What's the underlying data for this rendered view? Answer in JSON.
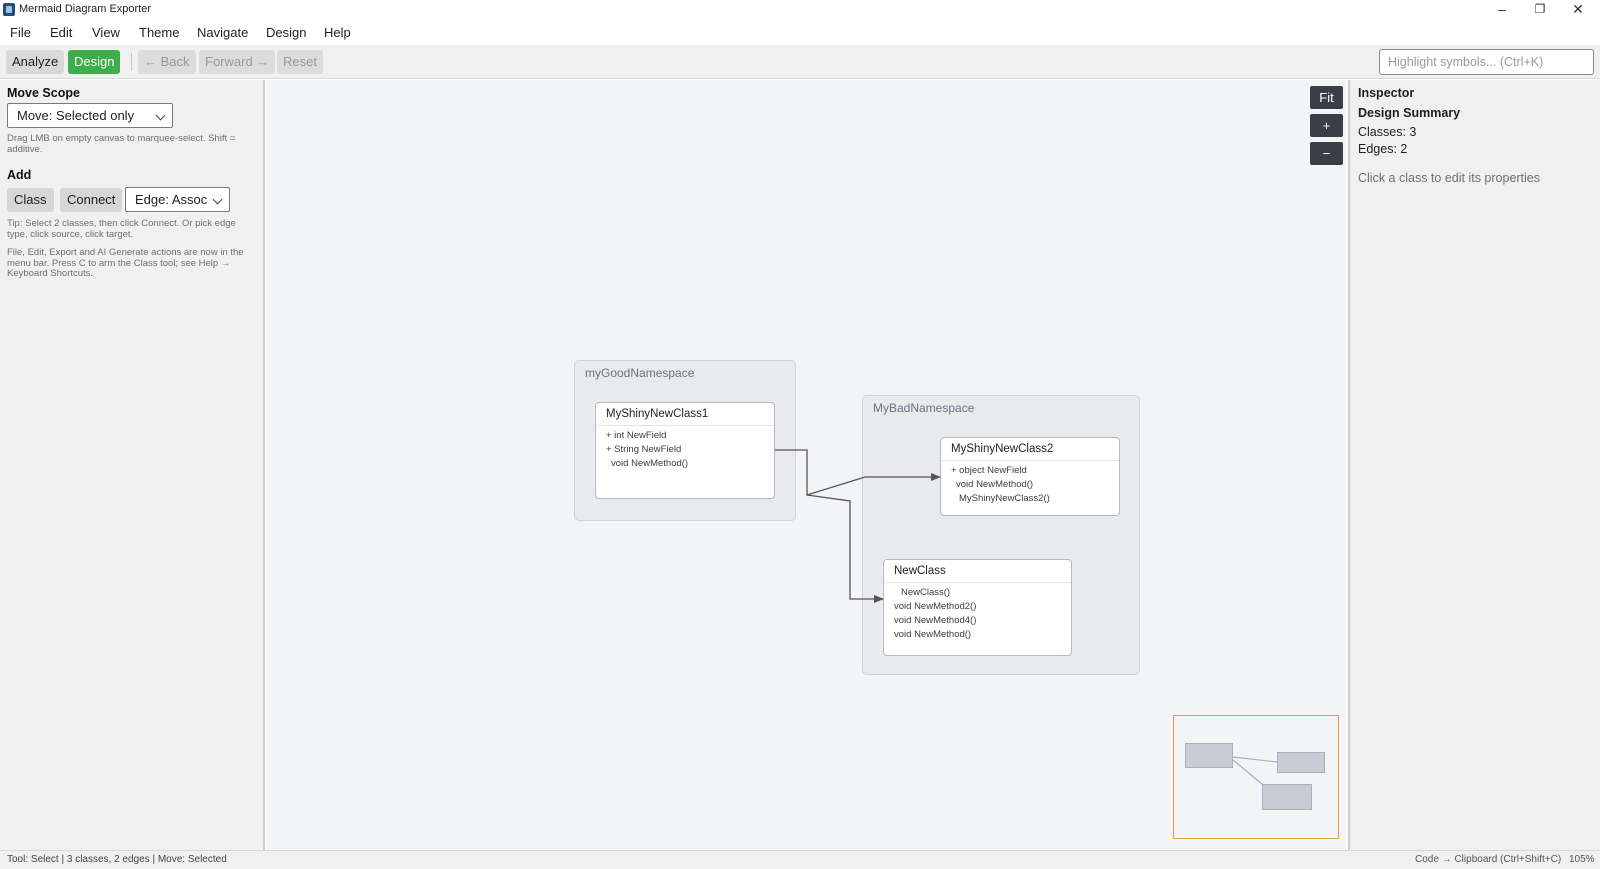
{
  "window": {
    "title": "Mermaid Diagram Exporter",
    "minimize": "–",
    "maximize": "❐",
    "close": "✕"
  },
  "menu": [
    "File",
    "Edit",
    "View",
    "Theme",
    "Navigate",
    "Design",
    "Help"
  ],
  "toolbar": {
    "analyze": "Analyze",
    "design": "Design",
    "back": "← Back",
    "forward": "Forward →",
    "reset": "Reset",
    "search_placeholder": "Highlight symbols... (Ctrl+K)"
  },
  "left_panel": {
    "move_scope_heading": "Move Scope",
    "move_scope_value": "Move: Selected only",
    "move_hint": "Drag LMB on empty canvas to marquee-select. Shift = additive.",
    "add_heading": "Add",
    "class_button": "Class",
    "connect_button": "Connect",
    "edge_type_value": "Edge: Assoc",
    "tip": "Tip: Select 2 classes, then click Connect. Or pick edge type, click source, click target.",
    "info": "File, Edit, Export and AI Generate actions are now in the menu bar. Press C to arm the Class tool; see Help → Keyboard Shortcuts."
  },
  "canvas": {
    "zoom_fit": "Fit",
    "zoom_in": "+",
    "zoom_out": "−",
    "namespaces": [
      {
        "name": "myGoodNamespace",
        "classes": [
          {
            "name": "MyShinyNewClass1",
            "members": [
              "+ int NewField",
              "+ String NewField",
              " void NewMethod()"
            ]
          }
        ]
      },
      {
        "name": "MyBadNamespace",
        "classes": [
          {
            "name": "MyShinyNewClass2",
            "members": [
              "+ object NewField",
              " void NewMethod()",
              "  MyShinyNewClass2()"
            ]
          },
          {
            "name": "NewClass",
            "members": [
              " NewClass()",
              "void NewMethod2()",
              "void NewMethod4()",
              "void NewMethod()"
            ]
          }
        ]
      }
    ],
    "edges": [
      {
        "from": "MyShinyNewClass1",
        "to": "MyShinyNewClass2",
        "type": "association"
      },
      {
        "from": "MyShinyNewClass1",
        "to": "NewClass",
        "type": "association"
      }
    ],
    "minimap_border_color": "#e0a43a"
  },
  "inspector": {
    "title": "Inspector",
    "summary_title": "Design Summary",
    "classes": "Classes: 3",
    "edges": "Edges: 2",
    "hint": "Click a class to edit its properties"
  },
  "status": {
    "left": "Tool: Select | 3 classes, 2 edges | Move: Selected",
    "clipboard": "Code → Clipboard  (Ctrl+Shift+C)",
    "zoom": "105%"
  },
  "colors": {
    "accent_green": "#3dae49",
    "zoom_button_bg": "#3a3f47"
  }
}
